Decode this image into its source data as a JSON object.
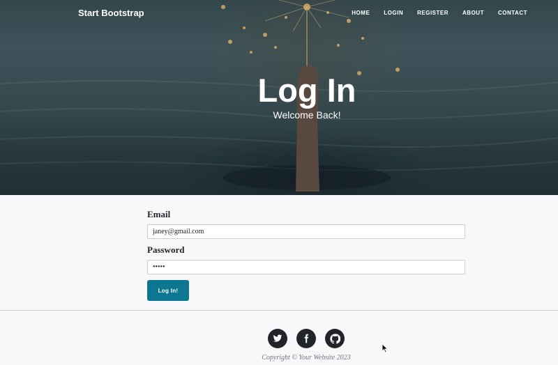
{
  "navbar": {
    "brand": "Start Bootstrap",
    "links": [
      "HOME",
      "LOGIN",
      "REGISTER",
      "ABOUT",
      "CONTACT"
    ]
  },
  "hero": {
    "title": "Log In",
    "subtitle": "Welcome Back!"
  },
  "form": {
    "email_label": "Email",
    "email_value": "janey@gmail.com",
    "password_label": "Password",
    "password_value": "•••••",
    "submit_label": "Log In!"
  },
  "footer": {
    "social_icons": [
      "twitter-icon",
      "facebook-icon",
      "github-icon"
    ],
    "copyright": "Copyright © Your Website 2023"
  },
  "colors": {
    "button": "#0d7691",
    "social_bg": "#212529",
    "footer_text": "#6c757d"
  }
}
